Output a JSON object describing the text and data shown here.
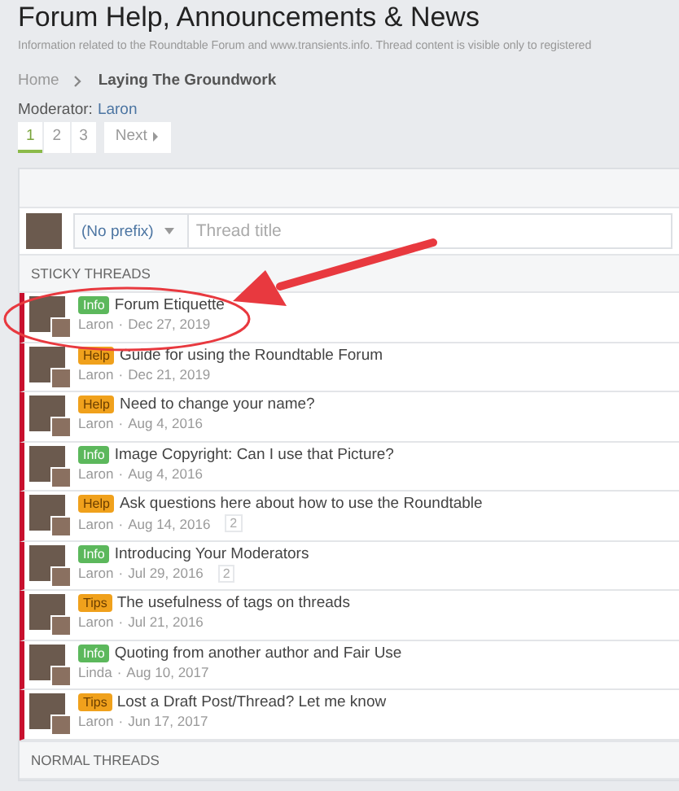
{
  "page": {
    "title": "Forum Help, Announcements & News",
    "description": "Information related to the Roundtable Forum and www.transients.info. Thread content is visible only to registered"
  },
  "breadcrumb": [
    {
      "label": "Home",
      "current": false
    },
    {
      "label": "Laying The Groundwork",
      "current": true
    }
  ],
  "moderator": {
    "label": "Moderator:",
    "name": "Laron"
  },
  "pagination": {
    "pages": [
      {
        "label": "1",
        "selected": true
      },
      {
        "label": "2",
        "selected": false
      },
      {
        "label": "3",
        "selected": false
      }
    ],
    "next": "Next"
  },
  "new_thread": {
    "prefix": "(No prefix)",
    "placeholder": "Thread title"
  },
  "sticky_header": "STICKY THREADS",
  "threads": [
    {
      "prefix": "Info",
      "kind": "info",
      "title": "Forum Etiquette",
      "author": "Laron",
      "sep": "·",
      "date": "Dec 27, 2019"
    },
    {
      "prefix": "Help",
      "kind": "help",
      "title": "Guide for using the Roundtable Forum",
      "author": "Laron",
      "sep": "·",
      "date": "Dec 21, 2019"
    },
    {
      "prefix": "Help",
      "kind": "help",
      "title": "Need to change your name?",
      "author": "Laron",
      "sep": "·",
      "date": "Aug 4, 2016"
    },
    {
      "prefix": "Info",
      "kind": "info",
      "title": "Image Copyright: Can I use that Picture?",
      "author": "Laron",
      "sep": "·",
      "date": "Aug 4, 2016"
    },
    {
      "prefix": "Help",
      "kind": "help",
      "title": "Ask questions here about how to use the Roundtable",
      "author": "Laron",
      "sep": "·",
      "date": "Aug 14, 2016",
      "replies": "2"
    },
    {
      "prefix": "Info",
      "kind": "info",
      "title": "Introducing Your Moderators",
      "author": "Laron",
      "sep": "·",
      "date": "Jul 29, 2016",
      "replies": "2"
    },
    {
      "prefix": "Tips",
      "kind": "tips",
      "title": "The usefulness of tags on threads",
      "author": "Laron",
      "sep": "·",
      "date": "Jul 21, 2016"
    },
    {
      "prefix": "Info",
      "kind": "info",
      "title": "Quoting from another author and Fair Use",
      "author": "Linda",
      "sep": "·",
      "date": "Aug 10, 2017"
    },
    {
      "prefix": "Tips",
      "kind": "tips",
      "title": "Lost a Draft Post/Thread? Let me know",
      "author": "Laron",
      "sep": "·",
      "date": "Jun 17, 2017"
    }
  ],
  "normal_header": "NORMAL THREADS"
}
